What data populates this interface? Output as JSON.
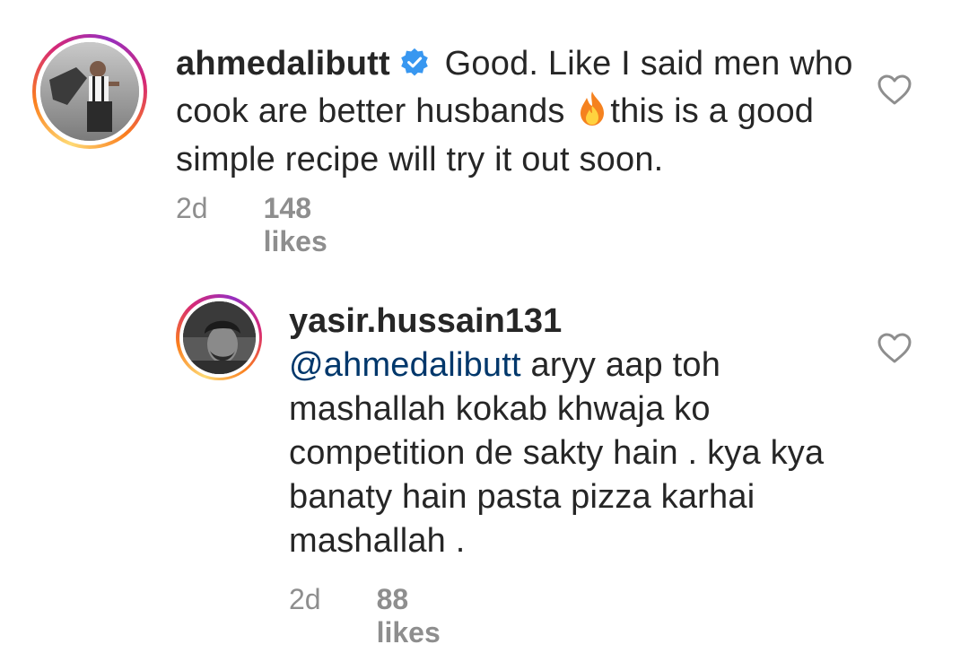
{
  "comments": [
    {
      "username": "ahmedalibutt",
      "verified": true,
      "text_part1": "Good. Like I said men who cook are better husbands",
      "emoji": "fire",
      "text_part2": "this is a good simple recipe will try it out soon.",
      "time": "2d",
      "likes": "148 likes"
    },
    {
      "username": "yasir.hussain131",
      "mention": "@ahmedalibutt",
      "text": "aryy aap toh mashallah kokab khwaja ko competition de sakty hain . kya kya banaty hain pasta pizza karhai mashallah .",
      "time": "2d",
      "likes": "88 likes"
    }
  ],
  "colors": {
    "text": "#262626",
    "meta": "#8e8e8e",
    "mention": "#00376b",
    "verified": "#3897f0"
  },
  "icons": {
    "like": "heart-outline-icon",
    "verified": "verified-badge-icon",
    "emoji": "fire-emoji"
  }
}
